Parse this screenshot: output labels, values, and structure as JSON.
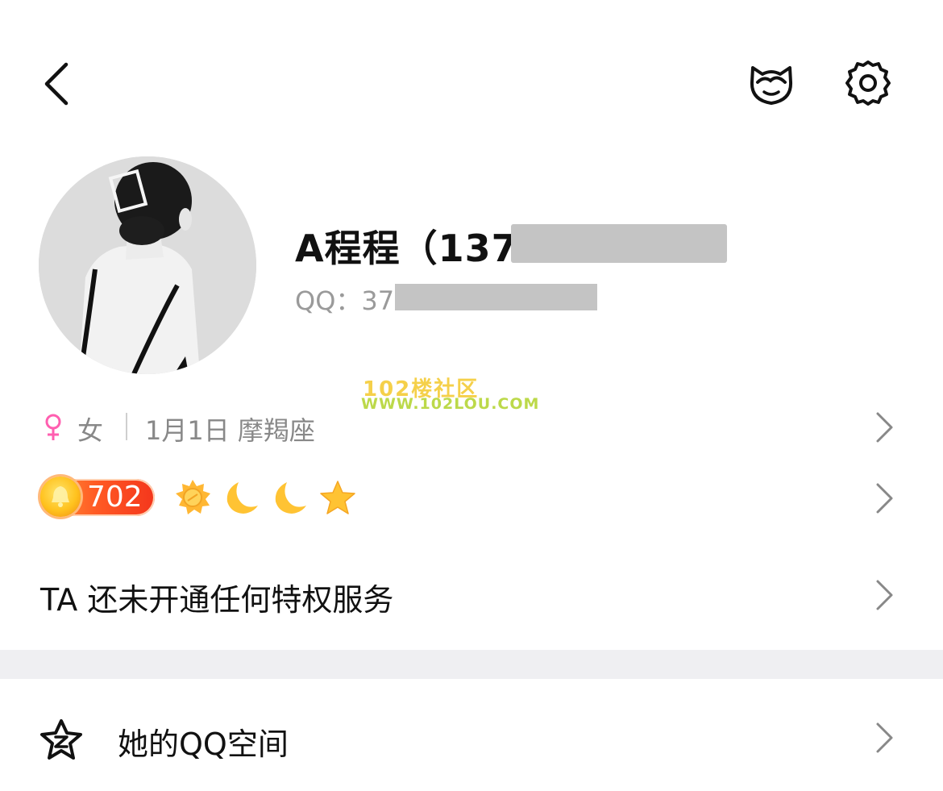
{
  "profile": {
    "name": "A程程（137",
    "qq_label": "QQ：37"
  },
  "watermark": {
    "title": "102楼社区",
    "url": "WWW.102LOU.COM"
  },
  "info": {
    "gender": "女",
    "birthday_sign": "1月1日 摩羯座"
  },
  "level": {
    "number": "702",
    "icons": [
      "sun-icon",
      "moon-icon",
      "moon-icon",
      "star-icon"
    ]
  },
  "privilege": {
    "text": "TA 还未开通任何特权服务"
  },
  "qzone": {
    "label": "她的QQ空间"
  },
  "colors": {
    "accent_orange": "#ff5a24",
    "female_pink": "#ff5fb0",
    "gray_text": "#888888",
    "section_gap": "#efeff2"
  }
}
